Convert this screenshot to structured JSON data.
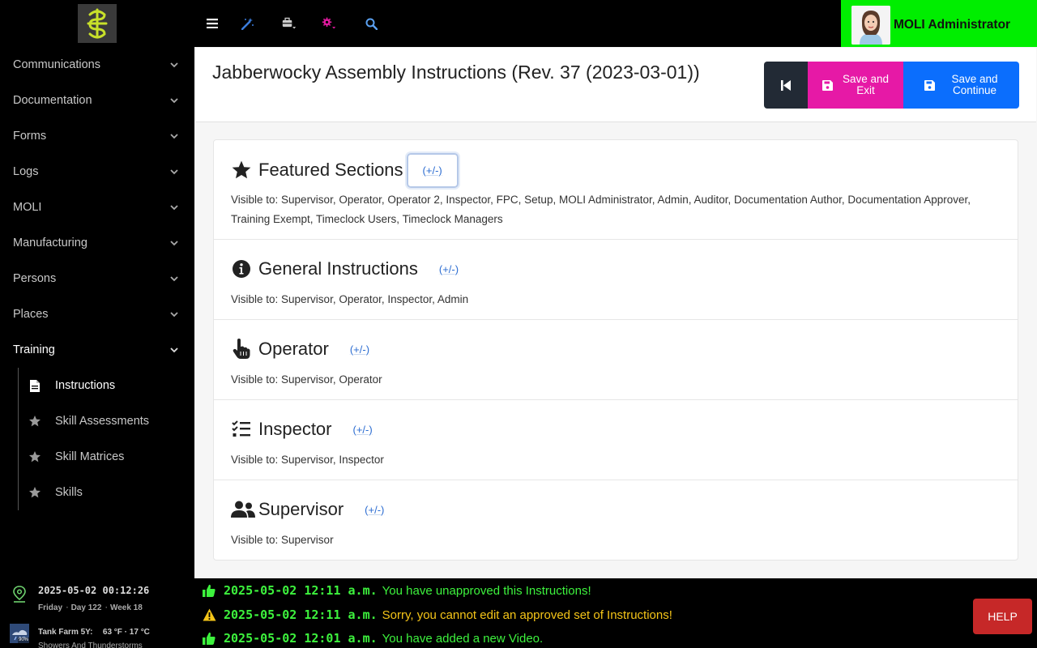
{
  "sidebar": {
    "logo": "logo-icon",
    "items": [
      {
        "label": "Communications"
      },
      {
        "label": "Documentation"
      },
      {
        "label": "Forms"
      },
      {
        "label": "Logs"
      },
      {
        "label": "MOLI"
      },
      {
        "label": "Manufacturing"
      },
      {
        "label": "Persons"
      },
      {
        "label": "Places"
      },
      {
        "label": "Training"
      }
    ],
    "training_sub": [
      {
        "label": "Instructions",
        "icon": "file-icon"
      },
      {
        "label": "Skill Assessments",
        "icon": "star-icon"
      },
      {
        "label": "Skill Matrices",
        "icon": "star-icon"
      },
      {
        "label": "Skills",
        "icon": "star-icon"
      }
    ],
    "status": {
      "datetime": "2025-05-02 00:12:26",
      "day": "Friday",
      "day_of_year": "Day 122",
      "week": "Week 18",
      "location": "Tank Farm 5Y:",
      "temps": "63 °F · 17 °C",
      "forecast": "Showers And Thunderstorms",
      "weather_badge": "90%"
    }
  },
  "topbar": {
    "user_name": "MOLI Administrator",
    "colors": {
      "accent": "#00ee00"
    }
  },
  "header": {
    "title": "Jabberwocky Assembly Instructions (Rev. 37 (2023-03-01))",
    "save_exit_label_1": "Save and",
    "save_exit_label_2": "Exit",
    "save_continue_label_1": "Save and",
    "save_continue_label_2": "Continue"
  },
  "sections": [
    {
      "title": "Featured Sections",
      "toggle": "(+/-)",
      "visible": "Visible to: Supervisor, Operator, Operator 2, Inspector, FPC, Setup, MOLI Administrator, Admin, Auditor, Documentation Author, Documentation Approver, Training Exempt, Timeclock Users, Timeclock Managers"
    },
    {
      "title": "General Instructions",
      "toggle": "(+/-)",
      "visible": "Visible to: Supervisor, Operator, Inspector, Admin"
    },
    {
      "title": "Operator",
      "toggle": "(+/-)",
      "visible": "Visible to: Supervisor, Operator"
    },
    {
      "title": "Inspector",
      "toggle": "(+/-)",
      "visible": "Visible to: Supervisor, Inspector"
    },
    {
      "title": "Supervisor",
      "toggle": "(+/-)",
      "visible": "Visible to: Supervisor"
    }
  ],
  "notifications": [
    {
      "time": "2025-05-02 12:11 a.m.",
      "message": "You have unapproved this Instructions!"
    },
    {
      "time": "2025-05-02 12:11 a.m.",
      "message": "Sorry, you cannot edit an approved set of Instructions!"
    },
    {
      "time": "2025-05-02 12:01 a.m.",
      "message": "You have added a new Video."
    }
  ],
  "help_label": "HELP"
}
